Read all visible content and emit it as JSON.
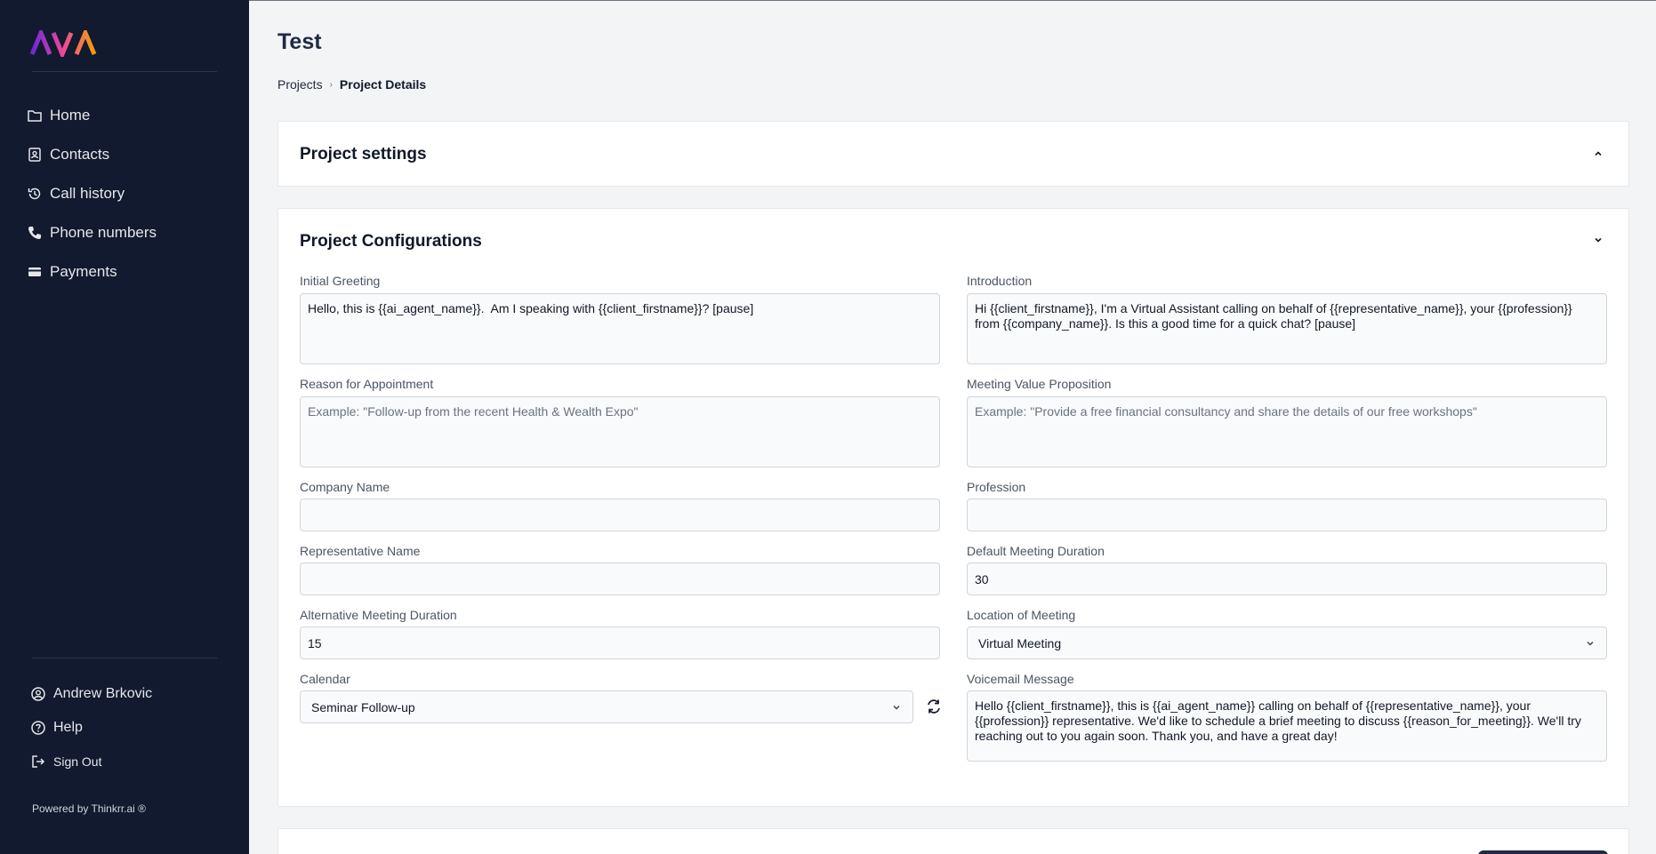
{
  "sidebar": {
    "logo_text": "AVA",
    "items": [
      {
        "label": "Home",
        "icon": "folder-icon"
      },
      {
        "label": "Contacts",
        "icon": "contacts-icon"
      },
      {
        "label": "Call history",
        "icon": "history-icon"
      },
      {
        "label": "Phone numbers",
        "icon": "phone-icon"
      },
      {
        "label": "Payments",
        "icon": "card-icon"
      }
    ],
    "user_name": "Andrew Brkovic",
    "help_label": "Help",
    "signout_label": "Sign Out",
    "powered_by": "Powered by Thinkrr.ai ®"
  },
  "page": {
    "title": "Test",
    "breadcrumb": [
      "Projects",
      "Project Details"
    ]
  },
  "settings_card": {
    "title": "Project settings"
  },
  "config_card": {
    "title": "Project Configurations",
    "initial_greeting": {
      "label": "Initial Greeting",
      "value": "Hello, this is {{ai_agent_name}}.  Am I speaking with {{client_firstname}}? [pause]"
    },
    "introduction": {
      "label": "Introduction",
      "value": "Hi {{client_firstname}}, I'm a Virtual Assistant calling on behalf of {{representative_name}}, your {{profession}} from {{company_name}}. Is this a good time for a quick chat? [pause]"
    },
    "reason": {
      "label": "Reason for Appointment",
      "placeholder": "Example: \"Follow-up from the recent Health & Wealth Expo\""
    },
    "value_prop": {
      "label": "Meeting Value Proposition",
      "placeholder": "Example: \"Provide a free financial consultancy and share the details of our free workshops\""
    },
    "company_name": {
      "label": "Company Name",
      "value": ""
    },
    "profession": {
      "label": "Profession",
      "value": ""
    },
    "representative_name": {
      "label": "Representative Name",
      "value": ""
    },
    "default_duration": {
      "label": "Default Meeting Duration",
      "value": "30"
    },
    "alt_duration": {
      "label": "Alternative Meeting Duration",
      "value": "15"
    },
    "location": {
      "label": "Location of Meeting",
      "value": "Virtual Meeting"
    },
    "calendar": {
      "label": "Calendar",
      "value": "Seminar Follow-up"
    },
    "voicemail": {
      "label": "Voicemail Message",
      "value": "Hello {{client_firstname}}, this is {{ai_agent_name}} calling on behalf of {{representative_name}}, your {{profession}} representative. We'd like to schedule a brief meeting to discuss {{reason_for_meeting}}. We'll try reaching out to you again soon. Thank you, and have a great day!"
    }
  },
  "colors": {
    "sidebar_bg": "#111a2e",
    "primary": "#1f2a44",
    "logo_gradient": [
      "#7c3aed",
      "#ec4899",
      "#f59e0b"
    ]
  }
}
